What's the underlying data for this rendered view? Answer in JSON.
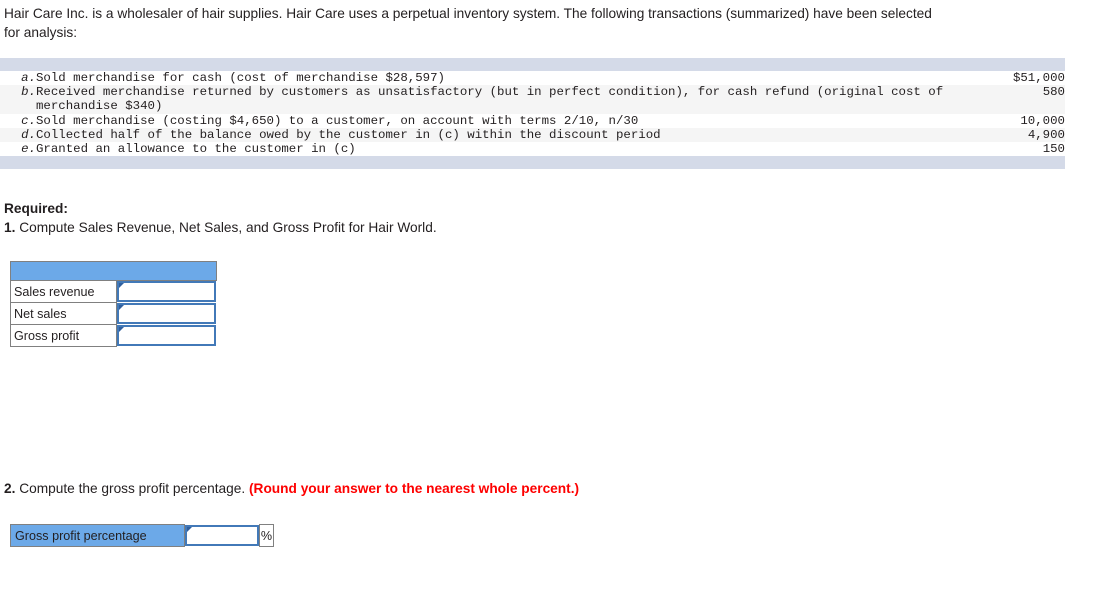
{
  "intro": {
    "paragraph": "Hair Care Inc. is a wholesaler of hair supplies. Hair Care uses a perpetual inventory system. The following transactions (summarized) have been selected for analysis:"
  },
  "transactions": {
    "rows": [
      {
        "letter": "a.",
        "description": "Sold merchandise for cash (cost of merchandise $28,597)",
        "amount": "$51,000"
      },
      {
        "letter": "b.",
        "description": "Received merchandise returned by customers as unsatisfactory (but in perfect condition), for cash refund (original cost of\nmerchandise $340)",
        "amount": "580"
      },
      {
        "letter": "c.",
        "description": "Sold merchandise (costing $4,650) to a customer, on account with terms 2/10, n/30",
        "amount": "10,000"
      },
      {
        "letter": "d.",
        "description": "Collected half of the balance owed by the customer in (c) within the discount period",
        "amount": "4,900"
      },
      {
        "letter": "e.",
        "description": "Granted an allowance to the customer in (c)",
        "amount": "150"
      }
    ]
  },
  "required": {
    "title": "Required:",
    "item1_number": "1.",
    "item1_text": " Compute Sales Revenue, Net Sales, and Gross Profit for Hair World."
  },
  "answer_table": {
    "header_label": "",
    "rows": [
      {
        "label": "Sales revenue",
        "value": "",
        "placeholder": ""
      },
      {
        "label": "Net sales",
        "value": "",
        "placeholder": ""
      },
      {
        "label": "Gross profit",
        "value": "",
        "placeholder": ""
      }
    ]
  },
  "part2": {
    "number": "2.",
    "text": " Compute the gross profit percentage. ",
    "note": "(Round your answer to the nearest whole percent.)"
  },
  "percentage_table": {
    "label": "Gross profit percentage",
    "value": "",
    "placeholder": "",
    "unit": "%"
  },
  "colors": {
    "header_blue": "#6ca9e8",
    "table_bar": "#d4dae8",
    "stripe": "#f5f5f5",
    "input_border": "#4279b8",
    "red_note": "#fe0000"
  }
}
